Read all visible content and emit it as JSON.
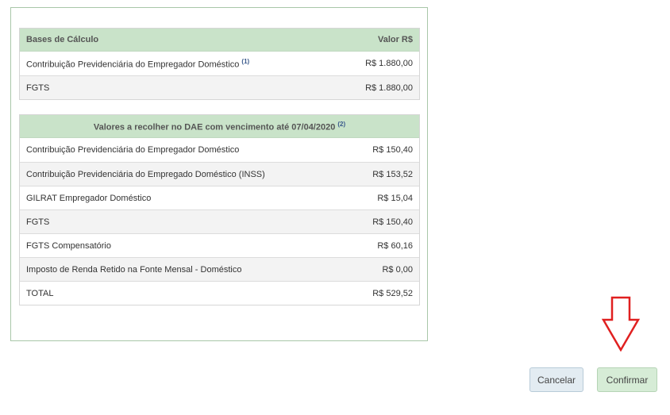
{
  "bases": {
    "header_left": "Bases de Cálculo",
    "header_right": "Valor R$",
    "rows": [
      {
        "label": "Contribuição Previdenciária do Empregador Doméstico",
        "note": "(1)",
        "value": "R$ 1.880,00"
      },
      {
        "label": "FGTS",
        "note": "",
        "value": "R$ 1.880,00"
      }
    ]
  },
  "dae": {
    "header": "Valores a recolher no DAE com vencimento até 07/04/2020",
    "header_note": "(2)",
    "rows": [
      {
        "label": "Contribuição Previdenciária do Empregador Doméstico",
        "value": "R$ 150,40"
      },
      {
        "label": "Contribuição Previdenciária do Empregado Doméstico (INSS)",
        "value": "R$ 153,52"
      },
      {
        "label": "GILRAT Empregador Doméstico",
        "value": "R$ 15,04"
      },
      {
        "label": "FGTS",
        "value": "R$ 150,40"
      },
      {
        "label": "FGTS Compensatório",
        "value": "R$ 60,16"
      },
      {
        "label": "Imposto de Renda Retido na Fonte Mensal - Doméstico",
        "value": "R$ 0,00"
      },
      {
        "label": "TOTAL",
        "value": "R$ 529,52"
      }
    ]
  },
  "buttons": {
    "cancel": "Cancelar",
    "confirm": "Confirmar"
  },
  "colors": {
    "header_bg": "#c9e3c9",
    "panel_border": "#a9c7a9",
    "arrow": "#e02020",
    "confirm_bg": "#d6ecd6",
    "cancel_bg": "#e3ecf2"
  },
  "icons": {
    "annotation": "down-arrow-icon"
  }
}
